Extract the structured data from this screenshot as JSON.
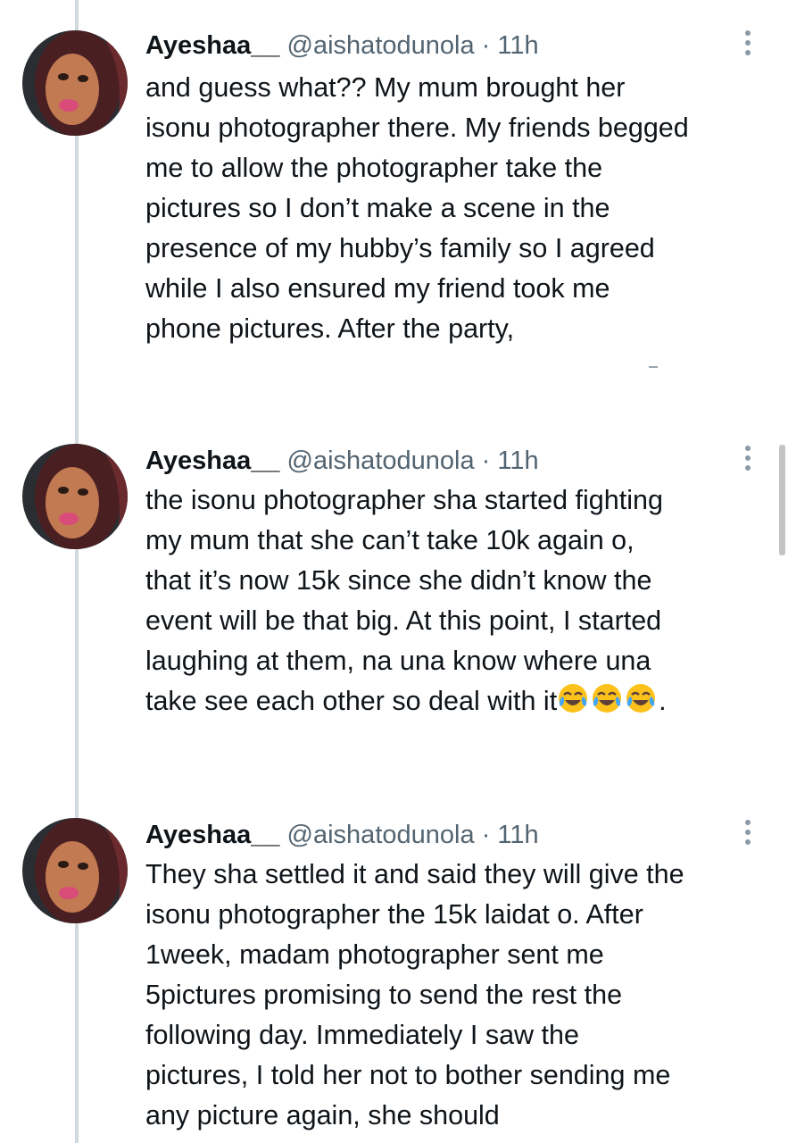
{
  "tweets": [
    {
      "display_name": "Ayeshaa__",
      "handle": "@aishatodunola",
      "separator": "·",
      "time": "11h",
      "lines": [
        "and guess what?? My mum brought her",
        "isonu photographer there. My friends begged",
        "me to allow the photographer take the",
        "pictures so I don’t make a scene in the",
        "presence of my hubby’s family so I agreed",
        "while I also ensured my friend took me",
        "phone pictures. After the party,"
      ]
    },
    {
      "display_name": "Ayeshaa__",
      "handle": "@aishatodunola",
      "separator": "·",
      "time": "11h",
      "lines": [
        "the isonu photographer sha started fighting",
        "my mum that she can’t take 10k again o,",
        "that it’s now 15k since she didn’t know the",
        "event will be that big. At this point, I started",
        "laughing at them, na una know where una",
        "take see each other so deal with it"
      ],
      "emoji": [
        "face-with-tears-of-joy",
        "face-with-tears-of-joy",
        "face-with-tears-of-joy"
      ],
      "trailing_text": "."
    },
    {
      "display_name": "Ayeshaa__",
      "handle": "@aishatodunola",
      "separator": "·",
      "time": "11h",
      "lines": [
        "They sha settled it and said they will give the",
        "isonu photographer the 15k laidat o. After",
        "1week, madam photographer sent me",
        "5pictures promising to send the rest the",
        "following day. Immediately I saw the",
        "pictures, I told her not to bother sending me",
        "any picture again, she should"
      ]
    }
  ],
  "icons": {
    "avatar": "profile-avatar",
    "more": "more-options-icon"
  },
  "colors": {
    "text": "#0f1419",
    "secondary": "#536471",
    "thread_line": "#cfd9de",
    "background": "#ffffff"
  }
}
